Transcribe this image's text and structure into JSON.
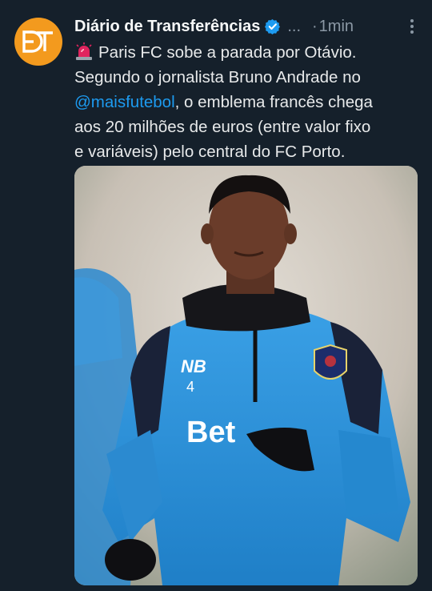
{
  "tweet": {
    "author_name": "Diário de Transferências",
    "handle": "...",
    "dot": "·",
    "time": "1min",
    "avatar_initials": "DT",
    "siren_emoji": "siren-icon",
    "lines": {
      "l1": "Paris FC sobe a parada por Otávio.",
      "l2": "Segundo o jornalista Bruno Andrade no",
      "mention": "@maisfutebol",
      "l3_rest": ", o emblema francês chega",
      "l4": "aos 20 milhões de euros (entre valor fixo",
      "l5": "e variáveis) pelo central do FC Porto."
    },
    "media": {
      "shirt_sponsor": "Bet",
      "shirt_number": "4"
    },
    "colors": {
      "background": "#15202b",
      "mention": "#1d9bf0",
      "verified": "#1d9bf0",
      "avatar": "#f39a1e",
      "shirt": "#2a8fd6"
    }
  }
}
